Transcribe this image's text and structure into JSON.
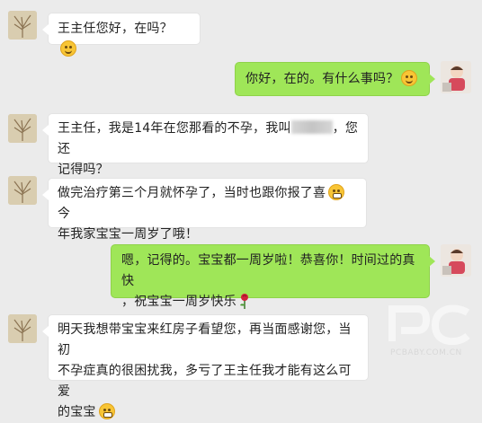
{
  "messages": [
    {
      "side": "left",
      "text": "王主任您好，在吗？",
      "emoji": "smile"
    },
    {
      "side": "right",
      "text": "你好，在的。有什么事吗？",
      "emoji": "smile"
    },
    {
      "side": "left",
      "line1_before": "王主任，我是14年在您那看的不孕，我叫",
      "line1_after": "，您还",
      "line2": "记得吗？"
    },
    {
      "side": "left",
      "line1": "做完治疗第三个月就怀孕了，当时也跟你报了喜",
      "line2": "年我家宝宝一周岁了哦！",
      "emoji_inline": "grin",
      "line1_tail": "今"
    },
    {
      "side": "right",
      "line1": "嗯，记得的。宝宝都一周岁啦！恭喜你！时间过的真快",
      "line2": "，祝宝宝一周岁快乐",
      "emoji": "rose"
    },
    {
      "side": "left",
      "line1": "明天我想带宝宝来红房子看望您，再当面感谢您，当初",
      "line2": "不孕症真的很困扰我，多亏了王主任我才能有这么可爱",
      "line3": "的宝宝"
    }
  ],
  "watermark": {
    "text": "PCBABY.COM.CN"
  },
  "colors": {
    "bg": "#ebebeb",
    "left_bubble": "#ffffff",
    "right_bubble": "#9fe658"
  }
}
